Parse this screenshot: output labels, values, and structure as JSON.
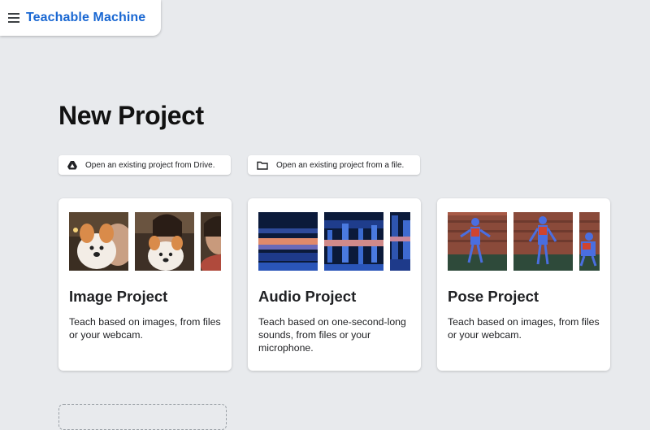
{
  "header": {
    "title": "Teachable Machine",
    "menu_icon": "hamburger-menu-icon"
  },
  "page": {
    "title": "New Project"
  },
  "open_buttons": [
    {
      "label": "Open an existing project from Drive.",
      "icon": "google-drive-icon"
    },
    {
      "label": "Open an existing project from a file.",
      "icon": "folder-icon"
    }
  ],
  "projects": [
    {
      "title": "Image Project",
      "description": "Teach based on images, from files or your webcam."
    },
    {
      "title": "Audio Project",
      "description": "Teach based on one-second-long sounds, from files or your microphone."
    },
    {
      "title": "Pose Project",
      "description": "Teach based on images, from files or your webcam."
    }
  ],
  "colors": {
    "brand": "#1967d2",
    "background": "#e8eaed",
    "card": "#ffffff"
  }
}
